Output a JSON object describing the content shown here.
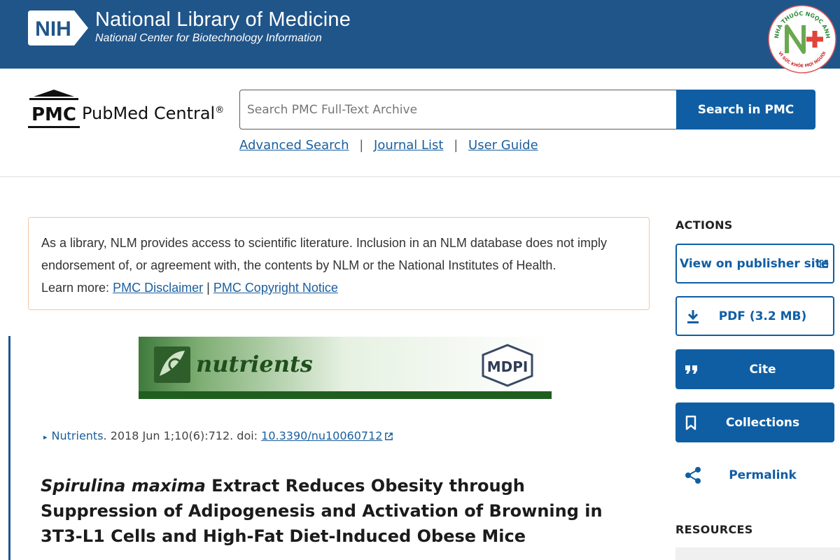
{
  "nih": {
    "logo_text": "NIH",
    "title": "National Library of Medicine",
    "subtitle": "National Center for Biotechnology Information"
  },
  "watermark": {
    "top_text": "NHÀ THUỐC NGỌC ANH",
    "bottom_text": "VÌ SỨC KHỎE MỌI NGƯỜI"
  },
  "pmc": {
    "logo_text": "PMC",
    "name": "PubMed Central",
    "registered": "®"
  },
  "search": {
    "placeholder": "Search PMC Full-Text Archive",
    "button_label": "Search in PMC"
  },
  "sub_links": {
    "advanced": "Advanced Search",
    "journal_list": "Journal List",
    "user_guide": "User Guide",
    "separator": "|"
  },
  "disclaimer": {
    "text": "As a library, NLM provides access to scientific literature. Inclusion in an NLM database does not imply endorsement of, or agreement with, the contents by NLM or the National Institutes of Health.",
    "learn_more": "Learn more:",
    "link1": "PMC Disclaimer",
    "separator": "|",
    "link2": "PMC Copyright Notice"
  },
  "journal_banner": {
    "name": "nutrients",
    "publisher": "MDPI"
  },
  "citation": {
    "journal": "Nutrients",
    "details": ". 2018 Jun 1;10(6):712. doi: ",
    "doi": "10.3390/nu10060712"
  },
  "article": {
    "title_italic": "Spirulina maxima",
    "title_rest": " Extract Reduces Obesity through Suppression of Adipogenesis and Activation of Browning in 3T3-L1 Cells and High-Fat Diet-Induced Obese Mice"
  },
  "sidebar": {
    "actions_heading": "ACTIONS",
    "publisher_site": "View on publisher site",
    "pdf": "PDF (3.2 MB)",
    "cite": "Cite",
    "collections": "Collections",
    "permalink": "Permalink",
    "resources_heading": "RESOURCES"
  },
  "colors": {
    "nih_blue": "#20558a",
    "primary": "#0f5ea4",
    "link": "#1a5f9e",
    "disclaimer_border": "#f1c6a8"
  }
}
